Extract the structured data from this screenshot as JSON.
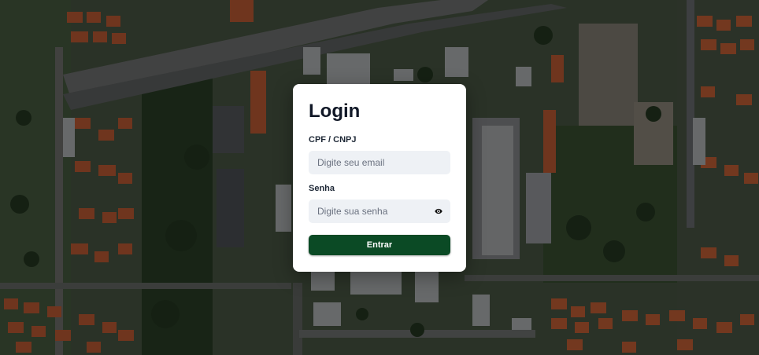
{
  "login": {
    "title": "Login",
    "user_label": "CPF / CNPJ",
    "user_placeholder": "Digite seu email",
    "password_label": "Senha",
    "password_placeholder": "Digite sua senha",
    "password_toggle_icon": "eye-icon",
    "submit_label": "Entrar"
  },
  "colors": {
    "button": "#0b4a25",
    "input_bg": "#eef1f5",
    "title": "#111827"
  }
}
